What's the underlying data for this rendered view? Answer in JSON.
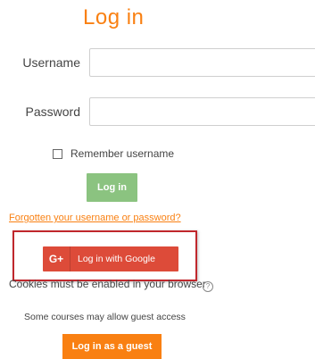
{
  "page": {
    "title": "Log in"
  },
  "form": {
    "username_label": "Username",
    "username_value": "",
    "password_label": "Password",
    "password_value": "",
    "remember_label": "Remember username",
    "remember_checked": false,
    "login_button": "Log in",
    "forgot_link": "Forgotten your username or password?"
  },
  "oauth": {
    "google_icon": "G+",
    "google_label": "Log in with Google"
  },
  "notes": {
    "cookies": "Cookies must be enabled in your browser",
    "guest_note": "Some courses may allow guest access",
    "guest_button": "Log in as a guest"
  },
  "colors": {
    "accent": "#f98012",
    "login_button": "#8bc380",
    "google_button": "#dd4b39",
    "highlight_frame": "#c0272d"
  },
  "icons": {
    "google": "google-plus-icon",
    "help": "help-icon"
  }
}
